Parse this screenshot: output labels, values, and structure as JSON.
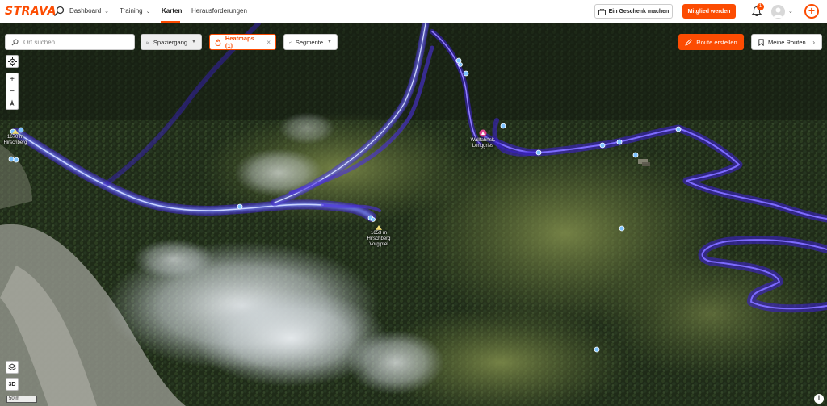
{
  "brand": {
    "logo": "STRAVA",
    "accent": "#fc4c02"
  },
  "nav": {
    "items": [
      {
        "label": "Dashboard",
        "has_chevron": true
      },
      {
        "label": "Training",
        "has_chevron": true
      },
      {
        "label": "Karten",
        "active": true
      },
      {
        "label": "Herausforderungen"
      }
    ],
    "gift_label": "Ein Geschenk machen",
    "member_label": "Mitglied werden",
    "notification_count": "1"
  },
  "map": {
    "search_placeholder": "Ort suchen",
    "sport_filter": "Spaziergang",
    "heatmap_filter": "Heatmaps (1)",
    "segments_filter": "Segmente",
    "create_route": "Route erstellen",
    "my_routes": "Meine Routen",
    "three_d": "3D",
    "scale_label": "50 m",
    "info": "i",
    "heat_color": "#5b3cff",
    "pois": [
      {
        "name": "1670 m\nHirschberg",
        "icon": "peak-icon"
      },
      {
        "name": "Wallfahrtsk.\nLenggries",
        "icon": "church-icon"
      },
      {
        "name": "1653 m\nHirschberg\nVorgipfel",
        "icon": "peak-icon"
      }
    ]
  }
}
